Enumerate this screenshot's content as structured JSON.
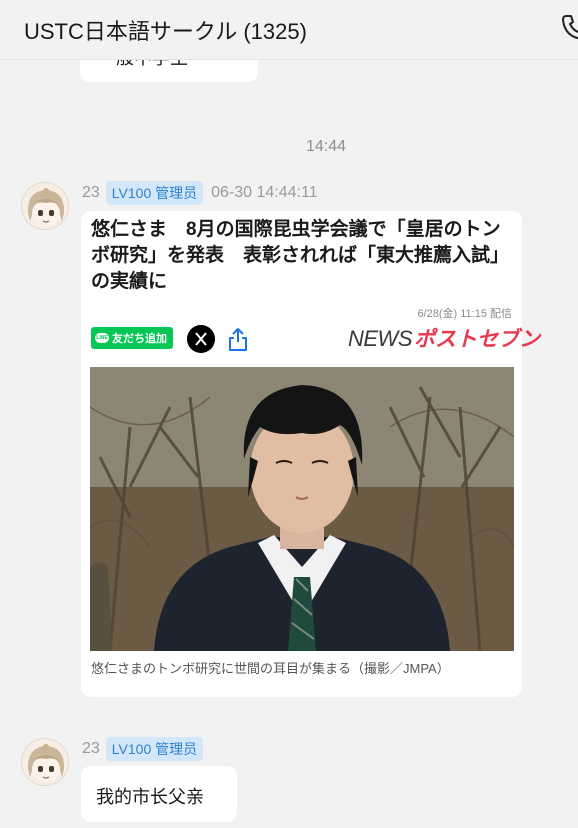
{
  "header": {
    "title": "USTC日本語サークル (1325)"
  },
  "chat": {
    "partial_message": "一般中学生",
    "time_separator": "14:44",
    "messages": [
      {
        "sender_id": "23",
        "badge": "LV100 管理员",
        "timestamp": "06-30 14:44:11",
        "article": {
          "title": "悠仁さま　8月の国際昆虫学会議で「皇居のトンボ研究」を発表　表彰されれば「東大推薦入試」の実績に",
          "date": "6/28(金) 11:15 配信",
          "line_button": "友だち追加",
          "line_logo": "LINE",
          "source_logo_news": "NEWS",
          "source_logo_brand": "ポストセブン",
          "caption": "悠仁さまのトンボ研究に世間の耳目が集まる（撮影／JMPA）"
        }
      },
      {
        "sender_id": "23",
        "badge": "LV100 管理员",
        "text": "我的市长父亲"
      }
    ]
  },
  "colors": {
    "background": "#f2f2f2",
    "bubble": "#ffffff",
    "badge_bg": "#d3e7fb",
    "badge_text": "#2d7fd1",
    "line_green": "#06c755",
    "brand_red": "#e8384f"
  },
  "icons": [
    "phone-icon",
    "avatar",
    "line-icon",
    "x-icon",
    "share-icon"
  ]
}
